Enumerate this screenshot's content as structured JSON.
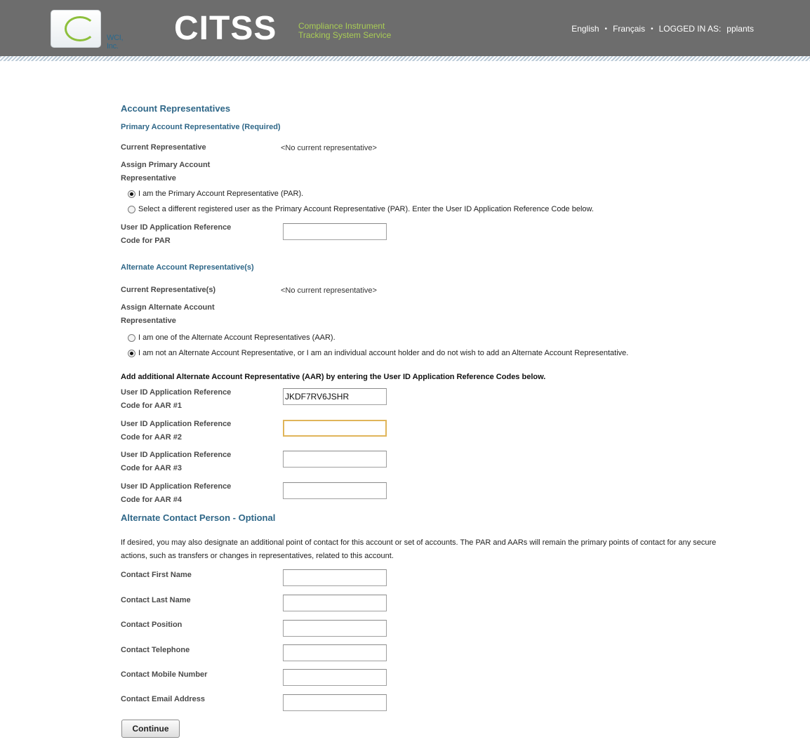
{
  "header": {
    "logo_text": "WCI, Inc.",
    "brand": "CITSS",
    "brand_sub_line1": "Compliance Instrument",
    "brand_sub_line2": "Tracking System Service",
    "lang_english": "English",
    "lang_french": "Français",
    "logged_in_label": "LOGGED IN AS:",
    "username": "pplants",
    "separator": "•"
  },
  "page": {
    "title": "Account Representatives",
    "primary": {
      "heading": "Primary Account Representative (Required)",
      "current_label": "Current Representative",
      "current_value": "<No current representative>",
      "assign_label_1": "Assign Primary Account",
      "assign_label_2": "Representative",
      "radio_self": "I am the Primary Account Representative (PAR).",
      "radio_other": "Select a different registered user as the Primary Account Representative (PAR). Enter the User ID Application Reference Code below.",
      "selected": "self",
      "code_label_1": "User ID Application Reference",
      "code_label_2": "Code for PAR",
      "code_value": ""
    },
    "alternate": {
      "heading": "Alternate Account Representative(s)",
      "current_label": "Current Representative(s)",
      "current_value": "<No current representative>",
      "assign_label_1": "Assign Alternate Account",
      "assign_label_2": "Representative",
      "radio_self": "I am one of the Alternate Account Representatives (AAR).",
      "radio_not": "I am not an Alternate Account Representative, or I am an individual account holder and do not wish to add an Alternate Account Representative.",
      "selected": "not",
      "add_note": "Add additional Alternate Account Representative (AAR) by entering the User ID Application Reference Codes below.",
      "codes": [
        {
          "label_1": "User ID Application Reference",
          "label_2": "Code for AAR #1",
          "value": "JKDF7RV6JSHR"
        },
        {
          "label_1": "User ID Application Reference",
          "label_2": "Code for AAR #2",
          "value": ""
        },
        {
          "label_1": "User ID Application Reference",
          "label_2": "Code for AAR #3",
          "value": ""
        },
        {
          "label_1": "User ID Application Reference",
          "label_2": "Code for AAR #4",
          "value": ""
        }
      ]
    },
    "contact": {
      "heading": "Alternate Contact Person - Optional",
      "description": "If desired, you may also designate an additional point of contact for this account or set of accounts. The PAR and AARs will remain the primary points of contact for any secure actions, such as transfers or changes in representatives, related to this account.",
      "fields": [
        {
          "label": "Contact First Name",
          "value": ""
        },
        {
          "label": "Contact Last Name",
          "value": ""
        },
        {
          "label": "Contact Position",
          "value": ""
        },
        {
          "label": "Contact Telephone",
          "value": ""
        },
        {
          "label": "Contact Mobile Number",
          "value": ""
        },
        {
          "label": "Contact Email Address",
          "value": ""
        }
      ]
    },
    "continue_label": "Continue"
  },
  "colors": {
    "header_bg": "#6d6d6d",
    "heading_blue": "#2f6788",
    "brand_green": "#a9cc55",
    "focus_border": "#e0b55a"
  }
}
